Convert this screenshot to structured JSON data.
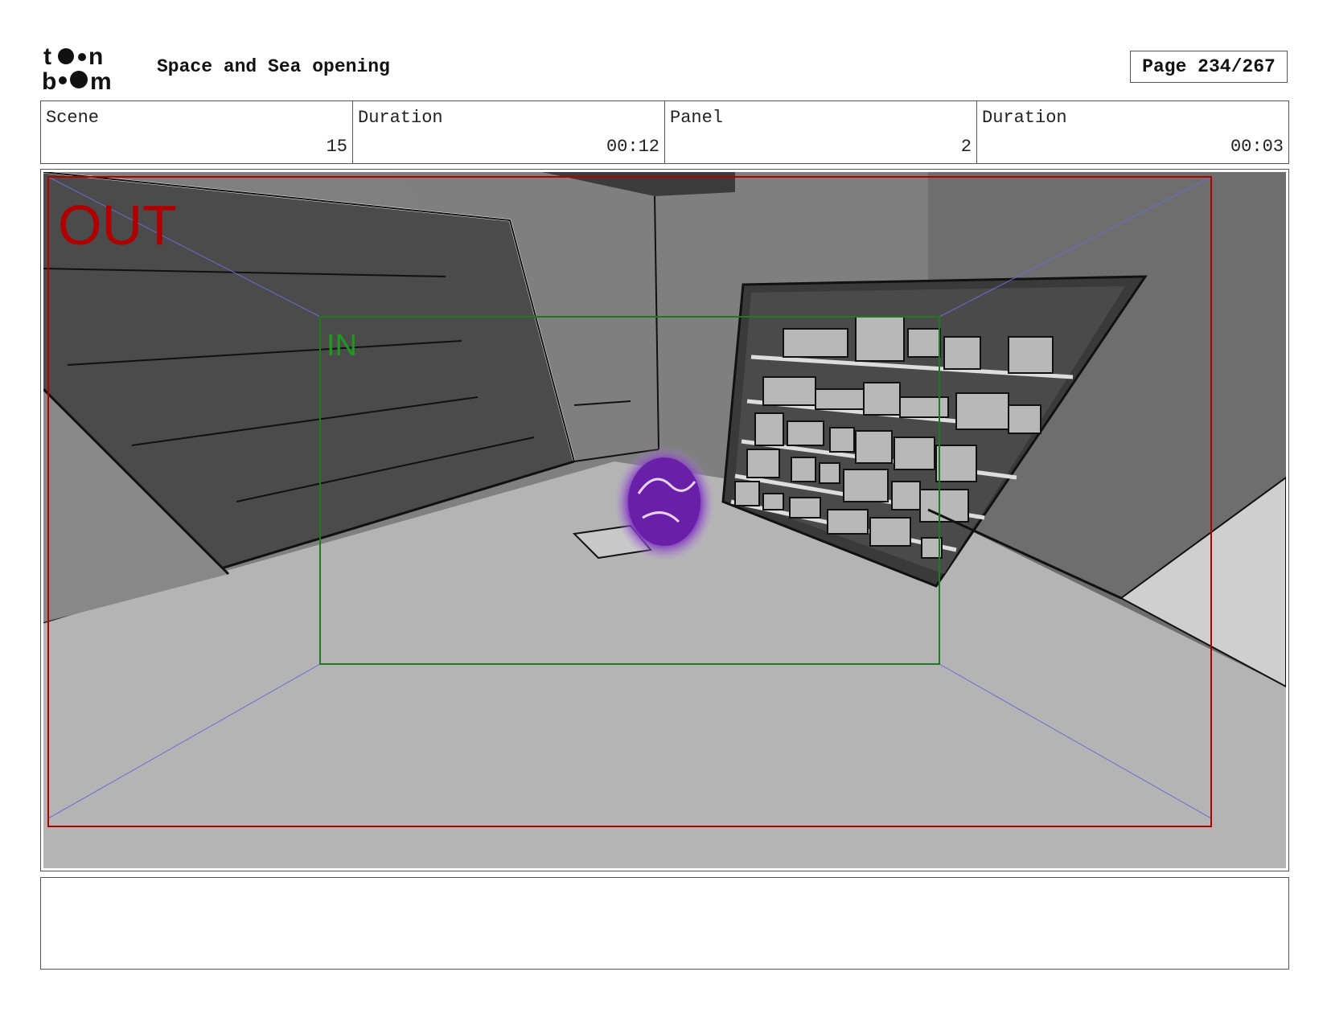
{
  "header": {
    "logo": {
      "line1": "toon",
      "line2": "boom"
    },
    "title": "Space and Sea opening",
    "page": "Page 234/267"
  },
  "info": {
    "scene_label": "Scene",
    "scene_value": "15",
    "scene_duration_label": "Duration",
    "scene_duration_value": "00:12",
    "panel_label": "Panel",
    "panel_value": "2",
    "panel_duration_label": "Duration",
    "panel_duration_value": "00:03"
  },
  "panel": {
    "out_label": "OUT",
    "in_label": "IN",
    "colors": {
      "out_frame": "#b00000",
      "in_frame": "#1d7a1d",
      "guide_lines": "#6b6bd0",
      "character": "#6a1fa8"
    }
  },
  "notes": {}
}
